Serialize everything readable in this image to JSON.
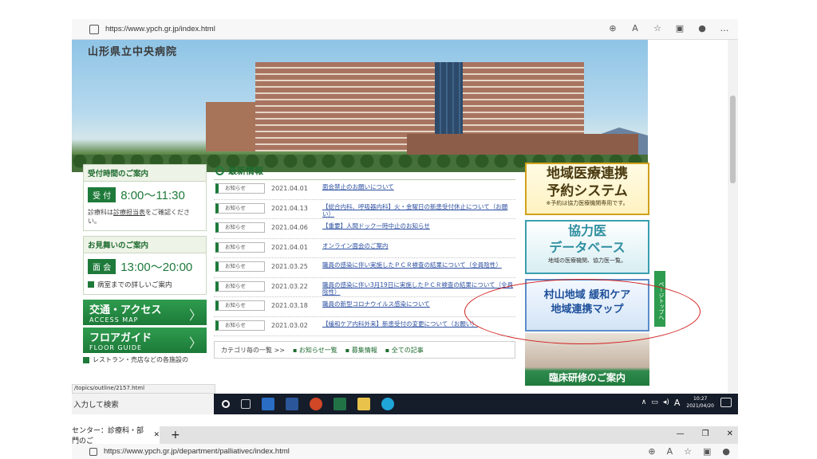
{
  "browser": {
    "url": "https://www.ypch.gr.jp/index.html",
    "icons": [
      "zoom-icon",
      "read-aloud-icon",
      "favorites-icon",
      "collections-icon",
      "profile-icon",
      "more-icon"
    ]
  },
  "hero": {
    "title": "山形県立中央病院"
  },
  "left": {
    "reception_heading": "受付時間のご案内",
    "reception_tag": "受 付",
    "reception_time": "8:00～11:30",
    "reception_note_a": "診療科は",
    "reception_note_link": "診療担当表",
    "reception_note_b": "をご確認ください。",
    "visit_heading": "お見舞いのご案内",
    "visit_tag": "面 会",
    "visit_time": "13:00～20:00",
    "ward_link": "病室までの詳しいご案内",
    "access_main": "交通・アクセス",
    "access_sub": "ACCESS MAP",
    "floor_main": "フロアガイド",
    "floor_sub": "FLOOR GUIDE",
    "restaurant": "レストラン・売店などの各施設の"
  },
  "news": {
    "heading": "最新情報",
    "items": [
      {
        "tag": "お知らせ",
        "date": "2021.04.01",
        "title": "面会禁止のお願いについて"
      },
      {
        "tag": "お知らせ",
        "date": "2021.04.13",
        "title": "【総合内科、呼吸器内科】火・金曜日の新患受付休止について（お願い）"
      },
      {
        "tag": "お知らせ",
        "date": "2021.04.06",
        "title": "【重要】人間ドック一時中止のお知らせ"
      },
      {
        "tag": "お知らせ",
        "date": "2021.04.01",
        "title": "オンライン面会のご案内"
      },
      {
        "tag": "お知らせ",
        "date": "2021.03.25",
        "title": "職員の感染に伴い実施したＰＣＲ検査の結果について（全員陰性）"
      },
      {
        "tag": "お知らせ",
        "date": "2021.03.22",
        "title": "職員の感染に伴い3月19日に実施したＰＣＲ検査の結果について（全員陰性）"
      },
      {
        "tag": "お知らせ",
        "date": "2021.03.18",
        "title": "職員の新型コロナウイルス感染について"
      },
      {
        "tag": "お知らせ",
        "date": "2021.03.02",
        "title": "【緩和ケア内科外来】新患受付の変更について（お願い）"
      }
    ],
    "category_label": "カテゴリ毎の一覧 >>",
    "category_links": [
      "お知らせ一覧",
      "募集情報",
      "全ての記事"
    ]
  },
  "banners": {
    "b1_line1": "地域医療連携",
    "b1_line2": "予約システム",
    "b1_sub": "※予約は協力医療機関専用です。",
    "b2_line1": "協力医",
    "b2_line2": "データベース",
    "b2_sub": "地域の医療機関、協力医一覧。",
    "b3_line1": "村山地域 緩和ケア",
    "b3_line2": "地域連携マップ",
    "b4": "臨床研修のご案内",
    "pagetop": "ページトップへ"
  },
  "status_url": "/topics/outline/2157.html",
  "taskbar": {
    "search": "入力して検索",
    "time": "10:27",
    "date": "2021/04/20",
    "ime": "A"
  },
  "window2": {
    "tab_title": "センター：診療科・部門のご",
    "url": "https://www.ypch.gr.jp/department/palliativec/index.html"
  },
  "colors": {
    "accent_green": "#1e7a3a",
    "annotation_red": "#d22020",
    "taskbar": "#151c2a"
  }
}
